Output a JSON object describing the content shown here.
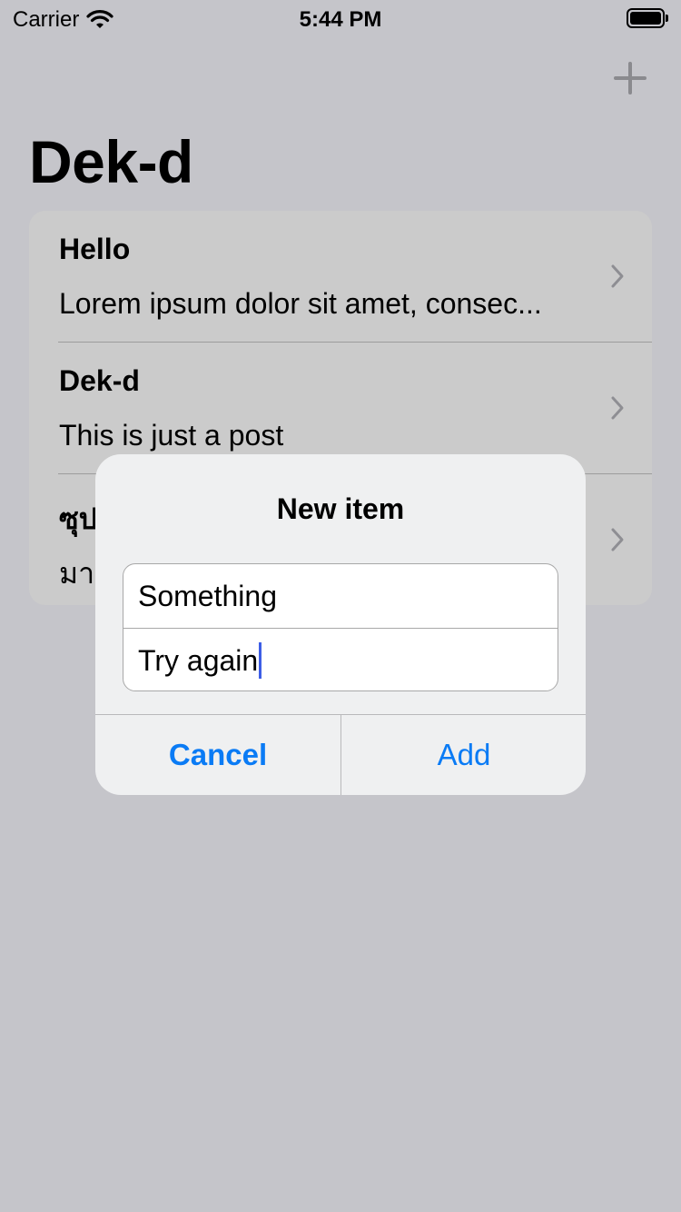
{
  "status_bar": {
    "carrier": "Carrier",
    "time": "5:44 PM"
  },
  "nav": {
    "title": "Dek-d",
    "add_icon": "plus-icon"
  },
  "list": {
    "items": [
      {
        "title": "Hello",
        "subtitle": "Lorem ipsum dolor sit amet, consec..."
      },
      {
        "title": "Dek-d",
        "subtitle": "This is just a post"
      },
      {
        "title": "ซุป",
        "subtitle": "มา"
      }
    ]
  },
  "alert": {
    "title": "New item",
    "fields": [
      {
        "value": "Something"
      },
      {
        "value": "Try again"
      }
    ],
    "cancel_label": "Cancel",
    "add_label": "Add"
  },
  "colors": {
    "background_dim": "#c5c5ca",
    "accent": "#0a7bf5",
    "caret": "#3d5ee6"
  }
}
